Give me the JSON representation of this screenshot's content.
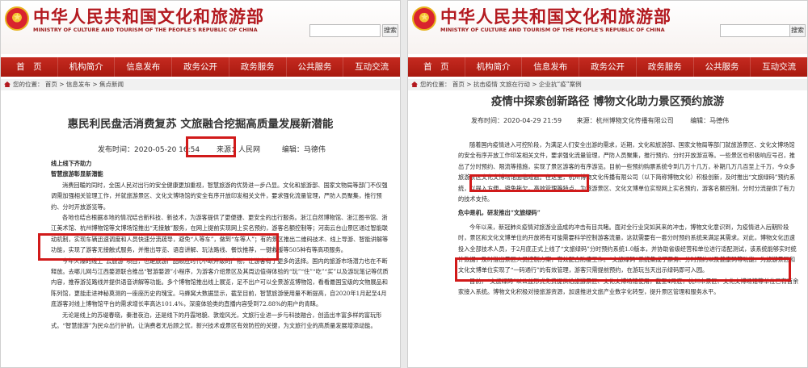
{
  "left": {
    "ministry_cn": "中华人民共和国文化和旅游部",
    "ministry_en": "MINISTRY OF CULTURE AND TOURISM OF THE PEOPLE'S REPUBLIC OF CHINA",
    "search_button": "搜索",
    "nav": [
      "首　页",
      "机构简介",
      "信息发布",
      "政务公开",
      "政务服务",
      "公共服务",
      "互动交流"
    ],
    "breadcrumb": "您的位置： 首页 > 信息发布 > 焦点新闻",
    "title": "惠民利民盘活消费复苏 文旅融合挖掘高质量发展新潜能",
    "publish_time": "发布时间：2020-05-20 16:54",
    "source": "来源：人民网",
    "editor": "编辑：马德伟",
    "body": [
      "线上线下齐助力",
      "智慧旅游彰显新潜能",
      "消费回暖的同时，全国人民对出行的安全健康更加重视，智慧旅游的优势进一步凸显。文化和旅游部、国家文物局等部门不仅强调需加强相关管理工作，并就旅游景区、文化文博场馆的安全有序开放印发相关文件，要求强化流量管理，严防人员聚集，推行预约、分时开放游览等。",
      "各地也结合根据本地的情况结合新科技、新技术，为游客提供了更便捷、更安全的出行服务。浙江自然博物馆、浙江图书馆、浙江美术馆、杭州博物馆等文博场馆推出“无接触”服务，在网上提前实现网上实名预约，游客名额控制等；河南云台山景区通过智能联动机制，实现车辆迅速调度和人员快速分流疏导，避免“人等车”，做到“车等人”；有的景区推出二维码技术、线上导游、智能讲解等功能，实现了游客无接触式服务，并推出导览、语音讲解、玩法路线、餐饮推荐，一键救援等505种有等高项服务。",
      "今年火爆的线上“云旅游”项目，也是旅游产品顺应时代不断升级的产物，让游客有了更多的选择。国内的旅游市场潜力也在不断释放。去哪儿网与江西婺源联合推出“智游婺源”小程序，为游客介绍景区及其周边值得体验的“玩”“住”“吃”“买”以及游玩笔记等优质内容，推荐游览路线并提供语音讲解等功能。多个博物馆推出线上展览，足不出户可以全景游览博物馆，看看最国宝级的文物展品和陈列馆，更能走进神秘莫测的一座座历史的瑰宝。马蜂窝大数据显示，截至目前，智慧旅游使用量不断提高，自2020年1月起至4月底游客对线上博物馆平台的需求增长率高达101.4%，深度体验类的直播内容受到72.88%的用户的青睐。",
      "无论是线上的苏堤春晓，秦淮夜泊，还是线下的丹霞地貌、敦煌风光，文旅行业进一步与科技融合，创造出丰富多样的富玩形式。“智慧旅游”为民众出行护航，让消费者无后顾之忧，新兴技术或景区有效防控的关键，为文旅行业的高质量发展增添动能。"
    ]
  },
  "right": {
    "ministry_cn": "中华人民共和国文化和旅游部",
    "ministry_en": "MINISTRY OF CULTURE AND TOURISM OF THE PEOPLE'S REPUBLIC OF CHINA",
    "search_button": "搜索",
    "nav": [
      "首　页",
      "机构简介",
      "信息发布",
      "政务公开",
      "政务服务",
      "公共服务",
      "互动交流"
    ],
    "breadcrumb": "您的位置： 首页 > 抗击疫情 文旅在行动 > 企业抗“疫”案例",
    "title": "疫情中探索创新路径 博物文化助力景区预约旅游",
    "publish_time": "发布时间：2020-04-29 21:59",
    "source": "来源：杭州博物文化传播有限公司",
    "editor": "编辑：马德伟",
    "body": [
      "随着国内疫情进入可控阶段，为满足人们安全出游的需求，近期，文化和旅游部、国家文物局等部门就旅游景区、文化文博场馆的安全有序开放工作印发相关文件，要求强化流量管理，严防人员聚集，推行预约、分时开放游览等。一些景区也积极响应号召，推出了分时预约、限流等措施，实现了景区游客的有序游览。目前一些预约购票系统令到几万十几万，补期几万几百至上千万，今众多旅游景区文化文博场馆面临难题。在这里，杭州博物文化传播有限公司（以下简称博物文化）积极创新，及时推出“文旅绿码”预约系统，以提入方便，避免拖欠，高效管理等特点，为旅游景区、文化文博单位实现网上实名预约，游客名额控制，分时分流提供了有力的技术支持。",
      "危中是机，研发推出“文旅绿码”",
      "今年以来，新冠肺炎疫情对旅游业造成的冲击有目共睹。面对全行业突如其来的冲击，博物文化意识到，为疫情进入后期阶段时，景区和文化文博单位的开放将有可能需要科学控制游客流量，这就需要有一套分时预约系统来满足其需求。对此，博物文化迅速投入全部技术人员，于2月底正式上线了“文旅绿码”分时预约系统1.0版本，并协助省级经营和单位进行适配测试，该系统能够实时统计数据，及时推出景区人员控制方案，有效配合防疫工作。“文旅绿码”系统集成了票务、分时预约以及健康码等功能，为旅游景区和文化文博单位实现了“一码通行”的有效管理，游客只需提前预约，在游玩当天出示绿码即可入园。",
      "目前，“文旅绿码”以公益形式免费提供给旅游景区、文化文博场馆使用，截至4月底，杭州市景区、文化文博场馆等单位已有百余家接入系统。博物文化积极对接旅游资源，加速推进文旅产业数字化转型，提升景区管理和服务水平。"
    ]
  }
}
